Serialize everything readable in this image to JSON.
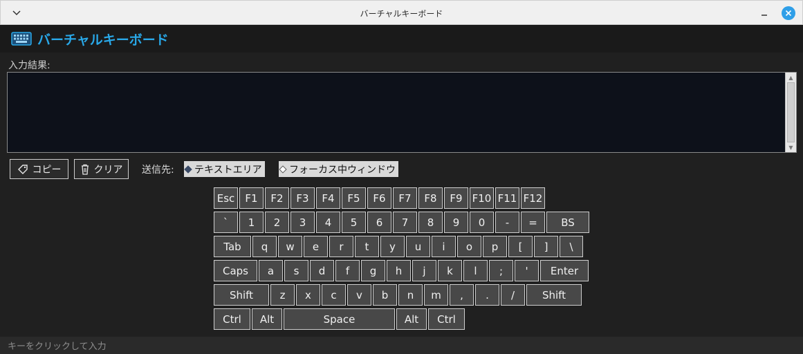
{
  "window": {
    "title": "バーチャルキーボード"
  },
  "app": {
    "title": "バーチャルキーボード"
  },
  "input": {
    "label": "入力結果:",
    "value": ""
  },
  "toolbar": {
    "copy_label": "コピー",
    "clear_label": "クリア",
    "send_to_label": "送信先:",
    "target_options": [
      {
        "label": "テキストエリア",
        "selected": true
      },
      {
        "label": "フォーカス中ウィンドウ",
        "selected": false
      }
    ]
  },
  "keyboard": {
    "rows": [
      [
        "Esc",
        "F1",
        "F2",
        "F3",
        "F4",
        "F5",
        "F6",
        "F7",
        "F8",
        "F9",
        "F10",
        "F11",
        "F12"
      ],
      [
        "`",
        "1",
        "2",
        "3",
        "4",
        "5",
        "6",
        "7",
        "8",
        "9",
        "0",
        "-",
        "=",
        "BS"
      ],
      [
        "Tab",
        "q",
        "w",
        "e",
        "r",
        "t",
        "y",
        "u",
        "i",
        "o",
        "p",
        "[",
        "]",
        "\\"
      ],
      [
        "Caps",
        "a",
        "s",
        "d",
        "f",
        "g",
        "h",
        "j",
        "k",
        "l",
        ";",
        "'",
        "Enter"
      ],
      [
        "Shift",
        "z",
        "x",
        "c",
        "v",
        "b",
        "n",
        "m",
        ",",
        ".",
        "/",
        "Shift"
      ],
      [
        "Ctrl",
        "Alt",
        "Space",
        "Alt",
        "Ctrl"
      ]
    ]
  },
  "status": {
    "text": "キーをクリックして入力"
  },
  "colors": {
    "accent": "#29a8e8",
    "close_button": "#2f9fe8"
  }
}
